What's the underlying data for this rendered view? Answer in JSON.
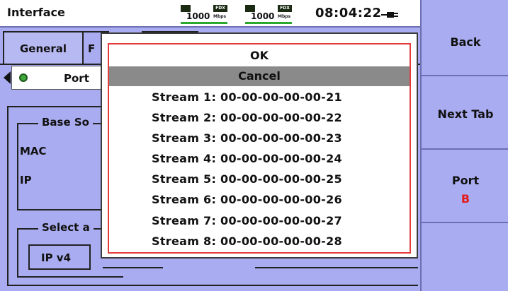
{
  "header": {
    "title": "Interface",
    "link1": {
      "speed": "1000",
      "duplex": "FDX",
      "unit": "Mbps"
    },
    "link2": {
      "speed": "1000",
      "duplex": "FDX",
      "unit": "Mbps"
    },
    "clock": "08:04:22"
  },
  "tabs": [
    {
      "label": "General",
      "active": true
    },
    {
      "label": "F",
      "active": false
    },
    {
      "label": "",
      "active": false
    }
  ],
  "port_selector": {
    "label": "Port",
    "led_color": "#3fa83a"
  },
  "base_group": {
    "label": "Base So",
    "fields": [
      "MAC",
      "IP"
    ]
  },
  "select_group": {
    "label": "Select a",
    "button": "IP v4"
  },
  "sidebar": {
    "back": "Back",
    "next_tab": "Next Tab",
    "port_label": "Port",
    "port_value": "B",
    "port_value_color": "#e31b1b"
  },
  "dropdown": {
    "ok": "OK",
    "cancel": "Cancel",
    "selected": "Cancel",
    "streams": [
      "Stream  1: 00-00-00-00-00-21",
      "Stream  2: 00-00-00-00-00-22",
      "Stream  3: 00-00-00-00-00-23",
      "Stream  4: 00-00-00-00-00-24",
      "Stream  5: 00-00-00-00-00-25",
      "Stream  6: 00-00-00-00-00-26",
      "Stream  7: 00-00-00-00-00-27",
      "Stream  8: 00-00-00-00-00-28"
    ]
  },
  "colors": {
    "background": "#a9acf0",
    "popup_border": "#e53b3b",
    "selection": "#8a8a8a",
    "link_ok": "#2ba82e"
  }
}
